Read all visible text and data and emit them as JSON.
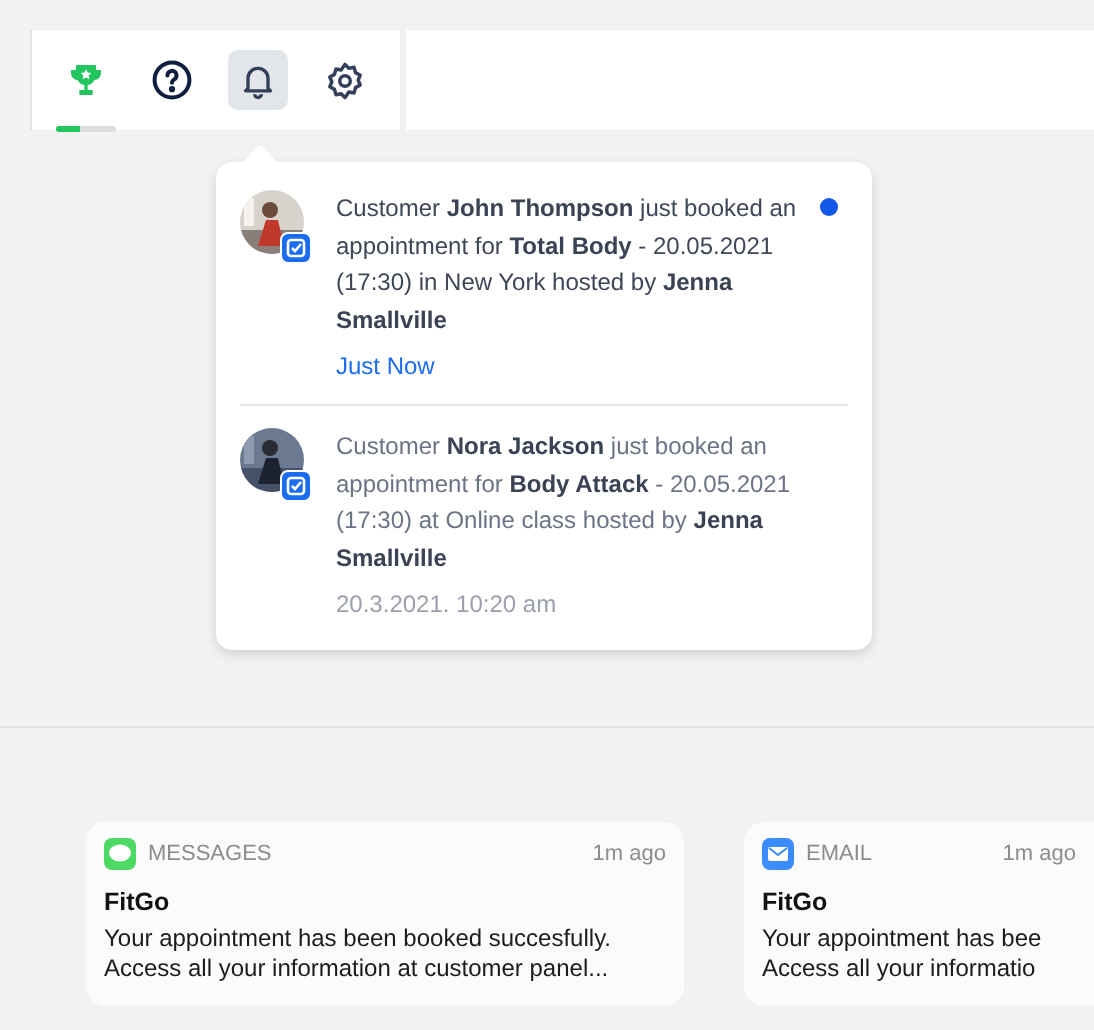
{
  "toolbar": {
    "items": [
      {
        "kind": "trophy",
        "selected": false,
        "level": 0.4
      },
      {
        "kind": "help",
        "selected": false
      },
      {
        "kind": "bell",
        "selected": true
      },
      {
        "kind": "settings",
        "selected": false
      }
    ]
  },
  "notifications": [
    {
      "text": "Customer **John Thompson** just booked an appointment for **Total Body** - 20.05.2021 (17:30) in New York hosted by **Jenna Smallville**",
      "time": "Just Now",
      "unread": true
    },
    {
      "text": "Customer **Nora Jackson** just booked an appointment for **Body Attack** - 20.05.2021 (17:30) at Online class hosted by **Jenna Smallville**",
      "time": "20.3.2021. 10:20 am",
      "unread": false
    }
  ],
  "push_cards": [
    {
      "kind": "messages",
      "app": "MESSAGES",
      "time": "1m ago",
      "title": "FitGo",
      "lines": [
        "Your appointment has been booked succesfully.",
        "Access all your information at customer panel..."
      ]
    },
    {
      "kind": "email",
      "app": "EMAIL",
      "time": "1m ago",
      "title": "FitGo",
      "lines": [
        "Your appointment has bee",
        "Access all your informatio"
      ]
    }
  ]
}
